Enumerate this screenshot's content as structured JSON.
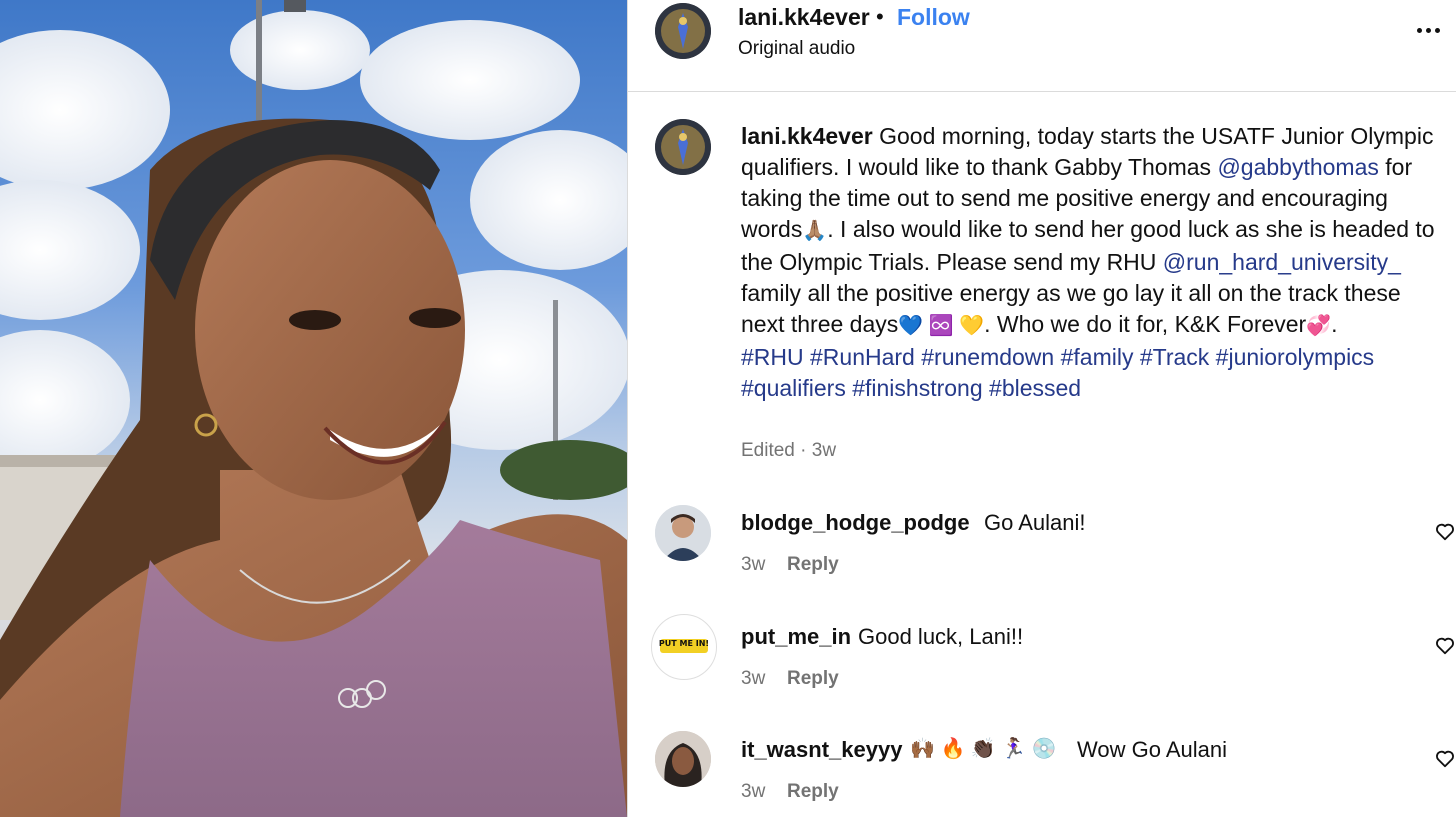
{
  "post": {
    "username": "lani.kk4ever",
    "dot": "•",
    "follow_label": "Follow",
    "audio": "Original audio"
  },
  "caption": {
    "username": "lani.kk4ever",
    "t1": " Good morning, today starts the USATF Junior Olympic qualifiers. I would like to thank Gabby Thomas ",
    "mention1": "@gabbythomas",
    "t2": " for taking the time out to send me positive energy and encouraging words",
    "emoji1": "🙏🏽",
    "t3": ". I also would like to send her good luck as she is headed to the Olympic Trials. Please send my RHU ",
    "mention2": "@run_hard_university_",
    "t4": " family all the positive energy as we go lay it all on the track these next three days",
    "emoji2": "💙 ♾️ 💛",
    "t5": ". Who we do it for, K&K Forever",
    "emoji3": "💞",
    "t6": ".",
    "hashtags_line1": "#RHU #RunHard #runemdown #family #Track #juniorolympics",
    "hashtags_line2": "#qualifiers #finishstrong #blessed",
    "meta": "Edited · 3w"
  },
  "comments": [
    {
      "username": "blodge_hodge_podge",
      "text": "Go Aulani!",
      "time": "3w",
      "reply_label": "Reply"
    },
    {
      "username": "put_me_in",
      "text": "Good luck, Lani!!",
      "time": "3w",
      "reply_label": "Reply",
      "avatar_text": "PUT ME IN!"
    },
    {
      "username": "it_wasnt_keyyy",
      "emojis": "🙌🏾 🔥 👏🏿 🏃🏽‍♀️ 💿",
      "text": "Wow Go Aulani",
      "time": "3w",
      "reply_label": "Reply"
    }
  ],
  "icons": {
    "more": "more-options-icon",
    "heart": "heart-icon"
  },
  "colors": {
    "follow": "#3b82f0",
    "link": "#263a8a",
    "muted": "#737373",
    "divider": "#dbdbdb"
  }
}
